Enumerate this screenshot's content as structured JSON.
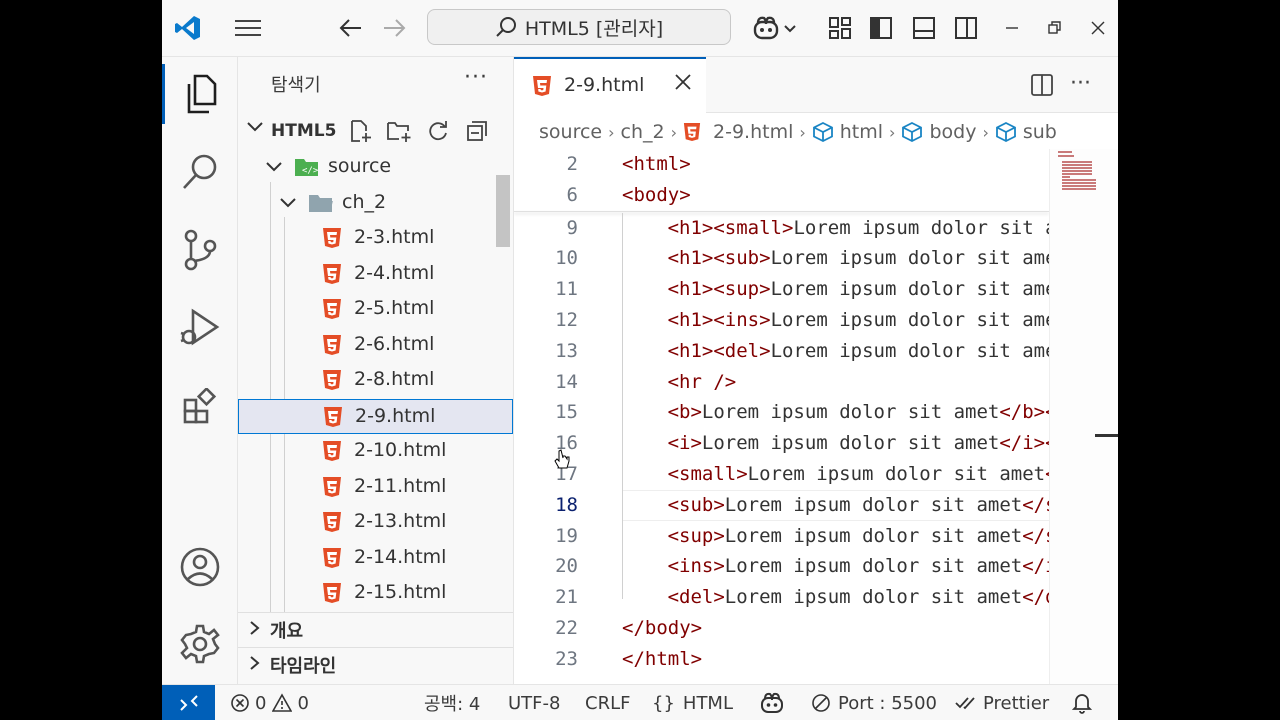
{
  "titlebar": {
    "search_text": "HTML5 [관리자]",
    "icons": [
      "vscode-logo-icon",
      "menu-icon",
      "back-arrow-icon",
      "forward-arrow-icon",
      "copilot-icon",
      "layout-customize-icon",
      "toggle-sidebar-icon",
      "toggle-panel-icon",
      "toggle-secondary-sidebar-icon",
      "minimize-icon",
      "restore-icon",
      "close-icon"
    ]
  },
  "activitybar": {
    "items": [
      "explorer-icon",
      "search-icon",
      "source-control-icon",
      "run-debug-icon",
      "extensions-icon",
      "accounts-icon",
      "settings-gear-icon"
    ]
  },
  "sidebar": {
    "title": "탐색기",
    "more": "···",
    "workspace": "HTML5",
    "tree": [
      {
        "label": "source",
        "kind": "folder-open"
      },
      {
        "label": "ch_2",
        "kind": "folder-open"
      },
      {
        "label": "2-3.html",
        "kind": "html"
      },
      {
        "label": "2-4.html",
        "kind": "html"
      },
      {
        "label": "2-5.html",
        "kind": "html"
      },
      {
        "label": "2-6.html",
        "kind": "html"
      },
      {
        "label": "2-8.html",
        "kind": "html"
      },
      {
        "label": "2-9.html",
        "kind": "html",
        "selected": true
      },
      {
        "label": "2-10.html",
        "kind": "html"
      },
      {
        "label": "2-11.html",
        "kind": "html"
      },
      {
        "label": "2-13.html",
        "kind": "html"
      },
      {
        "label": "2-14.html",
        "kind": "html"
      },
      {
        "label": "2-15.html",
        "kind": "html"
      }
    ],
    "outline_label": "개요",
    "timeline_label": "타임라인"
  },
  "editor": {
    "tab_label": "2-9.html",
    "tab_close": "×",
    "breadcrumbs": [
      "source",
      "ch_2",
      "2-9.html",
      "html",
      "body",
      "sub"
    ],
    "current_line": "18",
    "lines": [
      {
        "n": "2",
        "code": "<html>"
      },
      {
        "n": "6",
        "code": "<body>"
      },
      {
        "n": "9",
        "code": "<h1><small>Lorem ipsum dolor sit a"
      },
      {
        "n": "10",
        "code": "<h1><sub>Lorem ipsum dolor sit ame"
      },
      {
        "n": "11",
        "code": "<h1><sup>Lorem ipsum dolor sit ame"
      },
      {
        "n": "12",
        "code": "<h1><ins>Lorem ipsum dolor sit ame"
      },
      {
        "n": "13",
        "code": "<h1><del>Lorem ipsum dolor sit ame"
      },
      {
        "n": "14",
        "code": "<hr />"
      },
      {
        "n": "15",
        "code": "<b>Lorem ipsum dolor sit amet</b><"
      },
      {
        "n": "16",
        "code": "<i>Lorem ipsum dolor sit amet</i><"
      },
      {
        "n": "17",
        "code": "<small>Lorem ipsum dolor sit amet<"
      },
      {
        "n": "18",
        "code": "<sub>Lorem ipsum dolor sit amet</s"
      },
      {
        "n": "19",
        "code": "<sup>Lorem ipsum dolor sit amet</s"
      },
      {
        "n": "20",
        "code": "<ins>Lorem ipsum dolor sit amet</i"
      },
      {
        "n": "21",
        "code": "<del>Lorem ipsum dolor sit amet</d"
      },
      {
        "n": "22",
        "code": "</body>"
      },
      {
        "n": "23",
        "code": "</html>"
      }
    ]
  },
  "statusbar": {
    "errors": "0",
    "warnings": "0",
    "spaces": "공백: 4",
    "encoding": "UTF-8",
    "eol": "CRLF",
    "language": "HTML",
    "port": "Port : 5500",
    "formatter": "Prettier"
  },
  "colors": {
    "accent": "#005fb8",
    "html_icon": "#e44d26",
    "folder_icon": "#90a4ae",
    "source_folder_icon": "#4caf50",
    "tag_color": "#800000",
    "breadcrumb_symbol": "#1a85c4"
  }
}
